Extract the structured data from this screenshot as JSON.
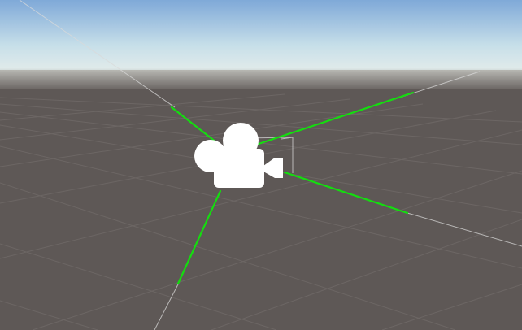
{
  "scene_view": {
    "sky_top_color": "#7fa9d8",
    "sky_bottom_color": "#dbe9ee",
    "ground_color": "#5e5856",
    "grid_line_color": "#6f6a68",
    "frustum_color": "#14dd0f",
    "camera_icon": "video-camera-icon",
    "camera_icon_color": "#ffffff"
  }
}
